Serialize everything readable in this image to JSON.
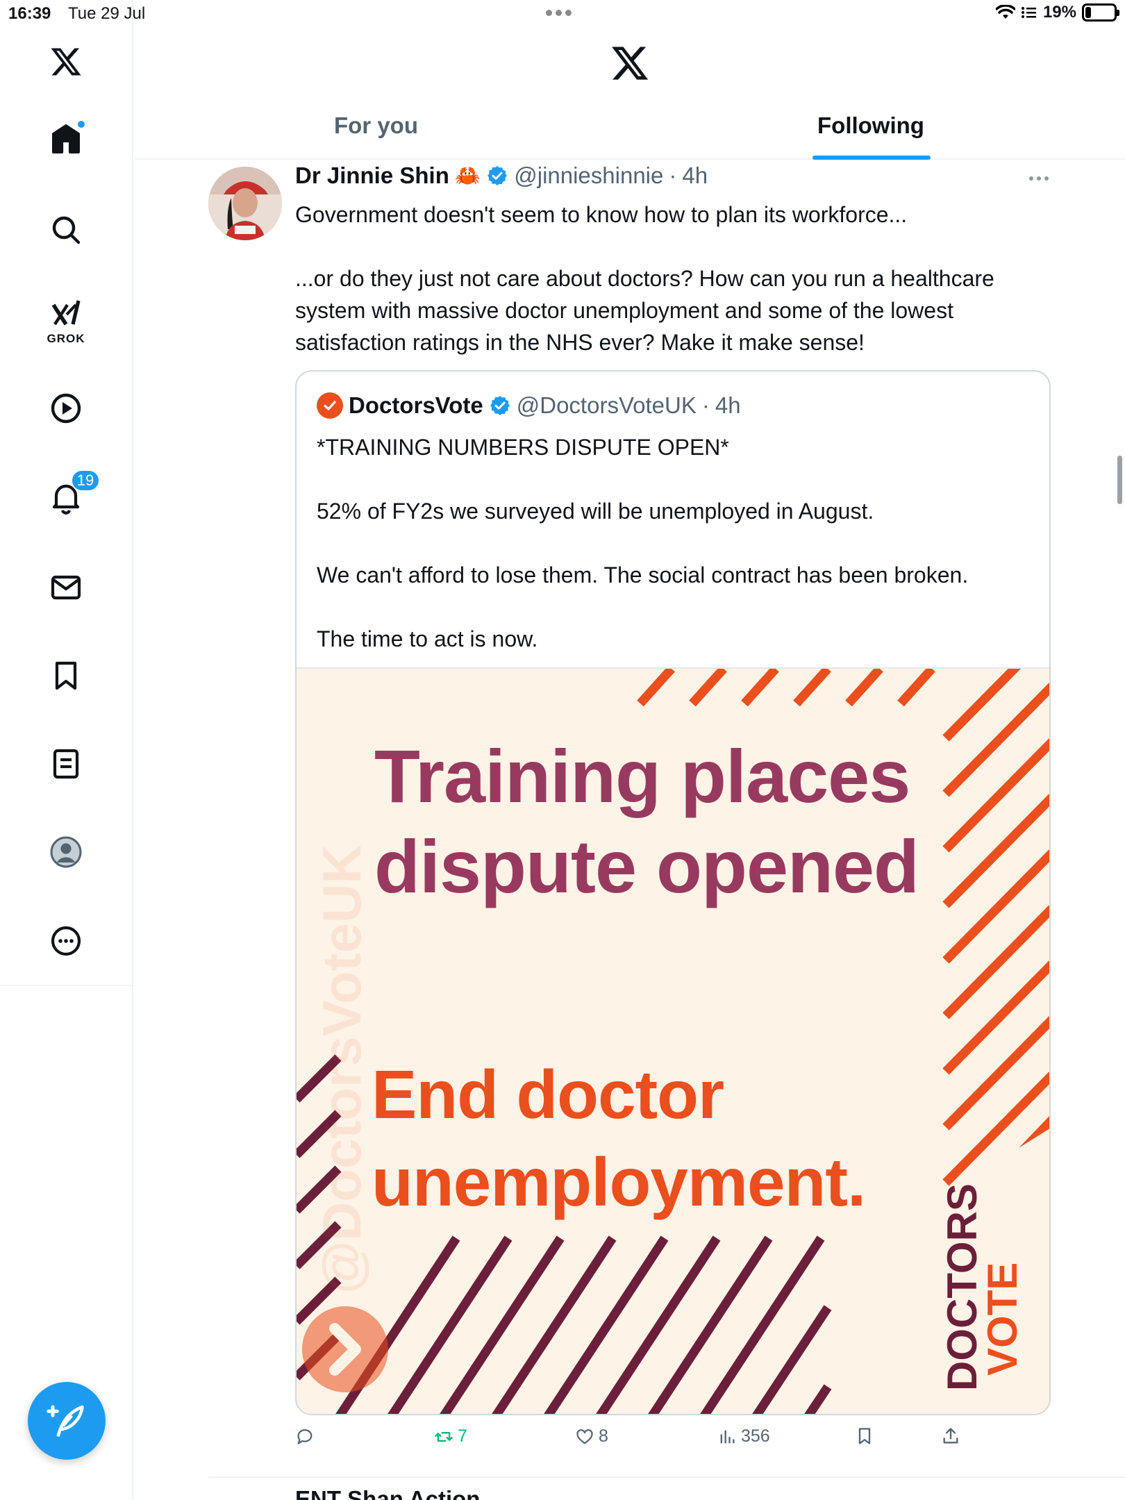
{
  "status_bar": {
    "time": "16:39",
    "date": "Tue 29 Jul",
    "battery": "19%",
    "battery_level": 0.19
  },
  "sidebar": {
    "items": [
      {
        "name": "home",
        "icon": "home-icon"
      },
      {
        "name": "explore",
        "icon": "search-icon"
      },
      {
        "name": "grok",
        "icon": "grok-icon",
        "label": "GROK"
      },
      {
        "name": "videos",
        "icon": "play-icon"
      },
      {
        "name": "notifications",
        "icon": "bell-icon",
        "badge": "19"
      },
      {
        "name": "messages",
        "icon": "mail-icon"
      },
      {
        "name": "bookmarks",
        "icon": "bookmark-icon"
      },
      {
        "name": "lists",
        "icon": "list-icon"
      },
      {
        "name": "profile",
        "icon": "avatar-icon"
      },
      {
        "name": "more",
        "icon": "more-icon"
      }
    ],
    "compose_icon": "compose-icon"
  },
  "header": {
    "tabs": [
      {
        "label": "For you",
        "active": false
      },
      {
        "label": "Following",
        "active": true
      }
    ]
  },
  "tweet": {
    "name": "Dr Jinnie Shin",
    "emoji": "🦀",
    "handle": "@jinnieshinnie",
    "time": "4h",
    "text": "Government doesn't seem to know how to plan its workforce...\n\n...or do they just not care about doctors? How can you run a healthcare system with massive doctor unemployment and some of the lowest satisfaction ratings in the NHS ever? Make it make sense!",
    "quote": {
      "name": "DoctorsVote",
      "handle": "@DoctorsVoteUK",
      "time": "4h",
      "text": "*TRAINING NUMBERS DISPUTE OPEN*\n\n52% of FY2s we surveyed will be unemployed in August.\n\nWe can't afford to lose them. The social contract has been broken.\n\nThe time to act is now.",
      "image": {
        "title": "Training places\ndispute opened",
        "cta": "End doctor\nunemployment.",
        "watermark": "@DoctorsVoteUK",
        "brand_top": "DOCTORS",
        "brand_bottom": "VOTE"
      }
    },
    "stats": {
      "replies": "",
      "retweets": "7",
      "likes": "8",
      "views": "356"
    }
  },
  "next_tweet_peek": "ENT Shan Action",
  "colors": {
    "accent": "#1d9bf0",
    "retweet_green": "#00ba7c",
    "promo_plum": "#983a5f",
    "promo_orange": "#ea4f1d",
    "promo_stripe_dark": "#6b1f3a"
  }
}
